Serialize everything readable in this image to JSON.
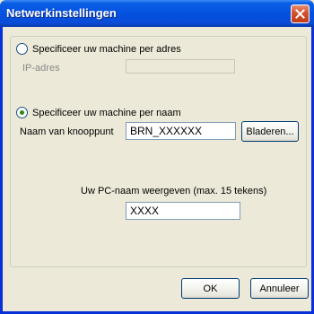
{
  "window": {
    "title": "Netwerkinstellingen"
  },
  "option_address": {
    "label": "Specificeer uw machine per adres",
    "selected": false,
    "ip_label": "IP-adres",
    "ip_value": ""
  },
  "option_name": {
    "label": "Specificeer uw machine per naam",
    "selected": true,
    "node_label": "Naam van knooppunt",
    "node_value": "BRN_XXXXXX",
    "browse_label": "Bladeren..."
  },
  "pc_name": {
    "label": "Uw PC-naam weergeven (max. 15 tekens)",
    "value": "XXXX"
  },
  "buttons": {
    "ok": "OK",
    "cancel": "Annuleer"
  },
  "colors": {
    "titlebar": "#0351DF",
    "close": "#C23B16",
    "background": "#ECE9D8"
  }
}
